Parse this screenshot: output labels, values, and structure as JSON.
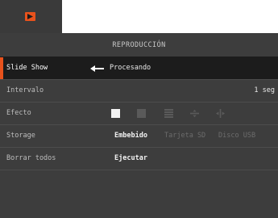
{
  "tabs": {
    "active_icon": "play-icon"
  },
  "panel": {
    "title": "REPRODUCCIÓN"
  },
  "rows": {
    "slideshow": {
      "label": "Slide Show",
      "status": "Procesando",
      "icon": "enter-icon"
    },
    "interval": {
      "label": "Intervalo",
      "value": "1 seg"
    },
    "effect": {
      "label": "Efecto",
      "options": [
        "effect-none-icon",
        "effect-dissolve-icon",
        "effect-blinds-icon",
        "effect-cross-icon",
        "effect-split-icon"
      ]
    },
    "storage": {
      "label": "Storage",
      "options": [
        "Embebido",
        "Tarjeta SD",
        "Disco USB"
      ],
      "selected": "Embebido"
    },
    "delete_all": {
      "label": "Borrar todos",
      "action": "Ejecutar"
    }
  },
  "colors": {
    "accent": "#e8521c",
    "panel": "#3d3d3d",
    "selected_row": "#1c1c1c"
  }
}
